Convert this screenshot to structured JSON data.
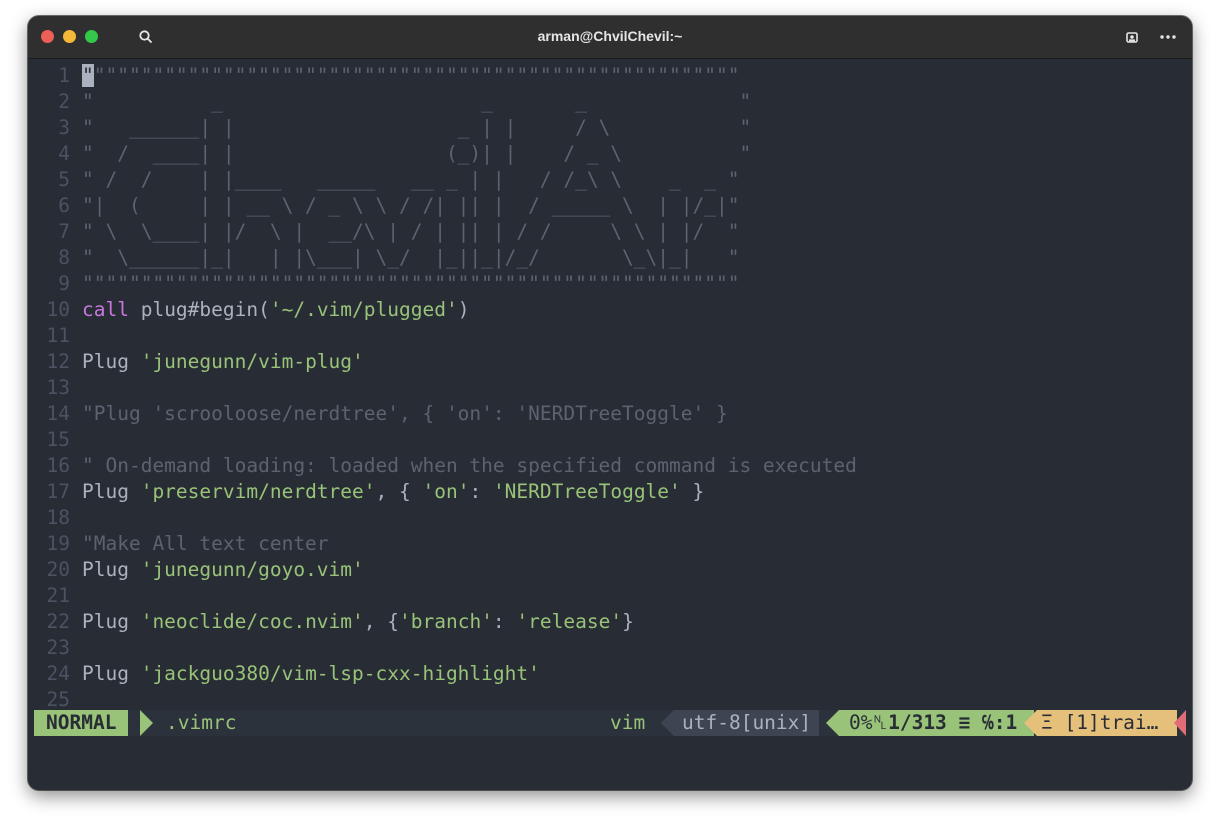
{
  "window": {
    "title": "arman@ChvilChevil:~"
  },
  "icons": {
    "search": "search-icon",
    "user": "user-icon",
    "menu": "more-icon"
  },
  "colors": {
    "background": "#282c34",
    "string": "#98c379",
    "keyword": "#c678dd",
    "comment": "#5c6370",
    "mode": "#98c379",
    "warning": "#e5c07b",
    "error": "#e06c75"
  },
  "editor": {
    "cursor_char": "\"",
    "lines": [
      {
        "n": "1",
        "t": "\"\"\"\"\"\"\"\"\"\"\"\"\"\"\"\"\"\"\"\"\"\"\"\"\"\"\"\"\"\"\"\"\"\"\"\"\"\"\"\"\"\"\"\"\"\"\"\"\"\"\"\"\"\"\"\"",
        "c": "cm"
      },
      {
        "n": "2",
        "t": "\"          _                      _       _             \"",
        "c": "cm"
      },
      {
        "n": "3",
        "t": "\"   ______| |                   _ | |     / \\           \"",
        "c": "cm"
      },
      {
        "n": "4",
        "t": "\"  /  ____| |                  (_)| |    / _ \\          \"",
        "c": "cm"
      },
      {
        "n": "5",
        "t": "\" /  /    | |____   _____   __ _ | |   / /_\\ \\    _  _ \"",
        "c": "cm"
      },
      {
        "n": "6",
        "t": "\"|  (     | | __ \\ / _ \\ \\ / /| || |  / _____ \\  | |/_|\"",
        "c": "cm"
      },
      {
        "n": "7",
        "t": "\" \\  \\____| |/  \\ |  __/\\ | / | || | / /     \\ \\ | |/  \"",
        "c": "cm"
      },
      {
        "n": "8",
        "t": "\"  \\______|_|   | |\\___| \\_/  |_||_|/_/       \\_\\|_|   \"",
        "c": "cm"
      },
      {
        "n": "9",
        "t": "\"\"\"\"\"\"\"\"\"\"\"\"\"\"\"\"\"\"\"\"\"\"\"\"\"\"\"\"\"\"\"\"\"\"\"\"\"\"\"\"\"\"\"\"\"\"\"\"\"\"\"\"\"\"\"\"",
        "c": "cm"
      },
      {
        "n": "10",
        "kw": "call",
        "rest": " plug#begin(",
        "str": "'~/.vim/plugged'",
        "tail": ")"
      },
      {
        "n": "11"
      },
      {
        "n": "12",
        "pre": "Plug ",
        "str": "'junegunn/vim-plug'"
      },
      {
        "n": "13"
      },
      {
        "n": "14",
        "t": "\"Plug 'scrooloose/nerdtree', { 'on': 'NERDTreeToggle' }",
        "c": "cm"
      },
      {
        "n": "15"
      },
      {
        "n": "16",
        "t": "\" On-demand loading: loaded when the specified command is executed",
        "c": "cm"
      },
      {
        "n": "17",
        "pre": "Plug ",
        "str": "'preservim/nerdtree'",
        "mid": ", { ",
        "str2": "'on'",
        "mid2": ": ",
        "str3": "'NERDTreeToggle'",
        "tail": " }"
      },
      {
        "n": "18"
      },
      {
        "n": "19",
        "t": "\"Make All text center",
        "c": "cm"
      },
      {
        "n": "20",
        "pre": "Plug ",
        "str": "'junegunn/goyo.vim'"
      },
      {
        "n": "21"
      },
      {
        "n": "22",
        "pre": "Plug ",
        "str": "'neoclide/coc.nvim'",
        "mid": ", {",
        "str2": "'branch'",
        "mid2": ": ",
        "str3": "'release'",
        "tail": "}"
      },
      {
        "n": "23"
      },
      {
        "n": "24",
        "pre": "Plug ",
        "str": "'jackguo380/vim-lsp-cxx-highlight'"
      },
      {
        "n": "25"
      }
    ]
  },
  "status": {
    "mode": "NORMAL",
    "filename": ".vimrc",
    "filetype": "vim",
    "encoding": "utf-8[unix]",
    "percent": "0%",
    "line_symbol": "␤",
    "position": "1/313",
    "column_symbol": "≡ ℅:1",
    "warning": "Ξ [1]trai…"
  }
}
